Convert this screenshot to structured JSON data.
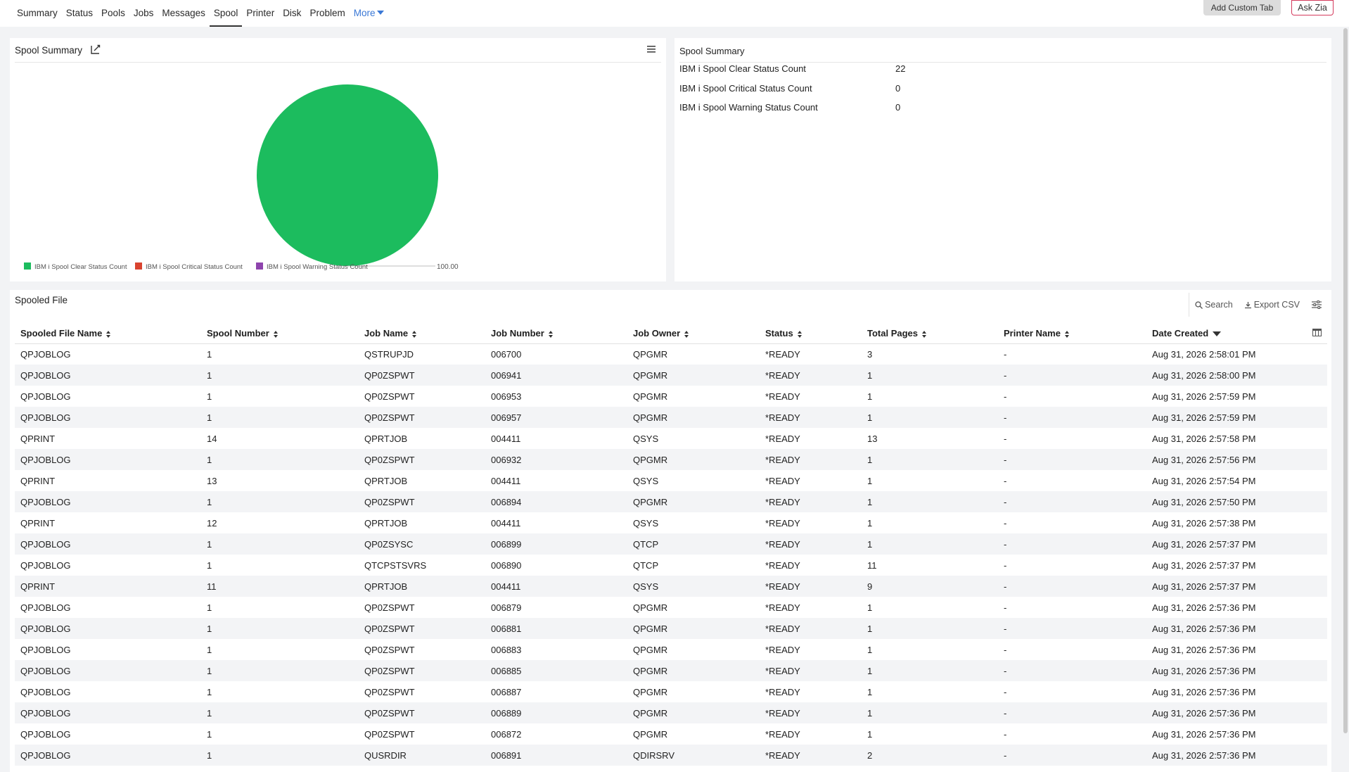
{
  "tabs": [
    {
      "label": "Summary"
    },
    {
      "label": "Status"
    },
    {
      "label": "Pools"
    },
    {
      "label": "Jobs"
    },
    {
      "label": "Messages"
    },
    {
      "label": "Spool",
      "active": true
    },
    {
      "label": "Printer"
    },
    {
      "label": "Disk"
    },
    {
      "label": "Problem"
    }
  ],
  "more_label": "More",
  "add_custom_tab_label": "Add Custom Tab",
  "ask_zia_label": "Ask Zia",
  "chart_panel": {
    "title": "Spool Summary",
    "icons": {
      "edit": "edit-chart-icon",
      "menu": "hamburger-menu-icon"
    }
  },
  "chart_data": {
    "type": "pie",
    "series": [
      {
        "name": "IBM i Spool Clear Status Count",
        "value": 100.0,
        "color": "#1cbc5e"
      },
      {
        "name": "IBM i Spool Critical Status Count",
        "value": 0,
        "color": "#d9432f"
      },
      {
        "name": "IBM i Spool Warning Status Count",
        "value": 0,
        "color": "#8e44ad"
      }
    ],
    "data_labels": [
      "100.00"
    ],
    "legend_position": "bottom-left"
  },
  "summary_panel": {
    "title": "Spool Summary",
    "rows": [
      {
        "label": "IBM i Spool Clear Status Count",
        "value": "22"
      },
      {
        "label": "IBM i Spool Critical Status Count",
        "value": "0"
      },
      {
        "label": "IBM i Spool Warning Status Count",
        "value": "0"
      }
    ]
  },
  "table_panel": {
    "title": "Spooled File",
    "tools": {
      "search": "Search",
      "export": "Export CSV"
    },
    "columns": [
      {
        "label": "Spooled File Name",
        "sort": "both"
      },
      {
        "label": "Spool Number",
        "sort": "both"
      },
      {
        "label": "Job Name",
        "sort": "both"
      },
      {
        "label": "Job Number",
        "sort": "both"
      },
      {
        "label": "Job Owner",
        "sort": "both"
      },
      {
        "label": "Status",
        "sort": "both"
      },
      {
        "label": "Total Pages",
        "sort": "both"
      },
      {
        "label": "Printer Name",
        "sort": "both"
      },
      {
        "label": "Date Created",
        "sort": "desc"
      }
    ],
    "rows": [
      [
        "QPJOBLOG",
        "1",
        "QSTRUPJD",
        "006700",
        "QPGMR",
        "*READY",
        "3",
        "-",
        "Aug 31, 2026 2:58:01 PM"
      ],
      [
        "QPJOBLOG",
        "1",
        "QP0ZSPWT",
        "006941",
        "QPGMR",
        "*READY",
        "1",
        "-",
        "Aug 31, 2026 2:58:00 PM"
      ],
      [
        "QPJOBLOG",
        "1",
        "QP0ZSPWT",
        "006953",
        "QPGMR",
        "*READY",
        "1",
        "-",
        "Aug 31, 2026 2:57:59 PM"
      ],
      [
        "QPJOBLOG",
        "1",
        "QP0ZSPWT",
        "006957",
        "QPGMR",
        "*READY",
        "1",
        "-",
        "Aug 31, 2026 2:57:59 PM"
      ],
      [
        "QPRINT",
        "14",
        "QPRTJOB",
        "004411",
        "QSYS",
        "*READY",
        "13",
        "-",
        "Aug 31, 2026 2:57:58 PM"
      ],
      [
        "QPJOBLOG",
        "1",
        "QP0ZSPWT",
        "006932",
        "QPGMR",
        "*READY",
        "1",
        "-",
        "Aug 31, 2026 2:57:56 PM"
      ],
      [
        "QPRINT",
        "13",
        "QPRTJOB",
        "004411",
        "QSYS",
        "*READY",
        "1",
        "-",
        "Aug 31, 2026 2:57:54 PM"
      ],
      [
        "QPJOBLOG",
        "1",
        "QP0ZSPWT",
        "006894",
        "QPGMR",
        "*READY",
        "1",
        "-",
        "Aug 31, 2026 2:57:50 PM"
      ],
      [
        "QPRINT",
        "12",
        "QPRTJOB",
        "004411",
        "QSYS",
        "*READY",
        "1",
        "-",
        "Aug 31, 2026 2:57:38 PM"
      ],
      [
        "QPJOBLOG",
        "1",
        "QP0ZSYSC",
        "006899",
        "QTCP",
        "*READY",
        "1",
        "-",
        "Aug 31, 2026 2:57:37 PM"
      ],
      [
        "QPJOBLOG",
        "1",
        "QTCPSTSVRS",
        "006890",
        "QTCP",
        "*READY",
        "11",
        "-",
        "Aug 31, 2026 2:57:37 PM"
      ],
      [
        "QPRINT",
        "11",
        "QPRTJOB",
        "004411",
        "QSYS",
        "*READY",
        "9",
        "-",
        "Aug 31, 2026 2:57:37 PM"
      ],
      [
        "QPJOBLOG",
        "1",
        "QP0ZSPWT",
        "006879",
        "QPGMR",
        "*READY",
        "1",
        "-",
        "Aug 31, 2026 2:57:36 PM"
      ],
      [
        "QPJOBLOG",
        "1",
        "QP0ZSPWT",
        "006881",
        "QPGMR",
        "*READY",
        "1",
        "-",
        "Aug 31, 2026 2:57:36 PM"
      ],
      [
        "QPJOBLOG",
        "1",
        "QP0ZSPWT",
        "006883",
        "QPGMR",
        "*READY",
        "1",
        "-",
        "Aug 31, 2026 2:57:36 PM"
      ],
      [
        "QPJOBLOG",
        "1",
        "QP0ZSPWT",
        "006885",
        "QPGMR",
        "*READY",
        "1",
        "-",
        "Aug 31, 2026 2:57:36 PM"
      ],
      [
        "QPJOBLOG",
        "1",
        "QP0ZSPWT",
        "006887",
        "QPGMR",
        "*READY",
        "1",
        "-",
        "Aug 31, 2026 2:57:36 PM"
      ],
      [
        "QPJOBLOG",
        "1",
        "QP0ZSPWT",
        "006889",
        "QPGMR",
        "*READY",
        "1",
        "-",
        "Aug 31, 2026 2:57:36 PM"
      ],
      [
        "QPJOBLOG",
        "1",
        "QP0ZSPWT",
        "006872",
        "QPGMR",
        "*READY",
        "1",
        "-",
        "Aug 31, 2026 2:57:36 PM"
      ],
      [
        "QPJOBLOG",
        "1",
        "QUSRDIR",
        "006891",
        "QDIRSRV",
        "*READY",
        "2",
        "-",
        "Aug 31, 2026 2:57:36 PM"
      ]
    ]
  }
}
